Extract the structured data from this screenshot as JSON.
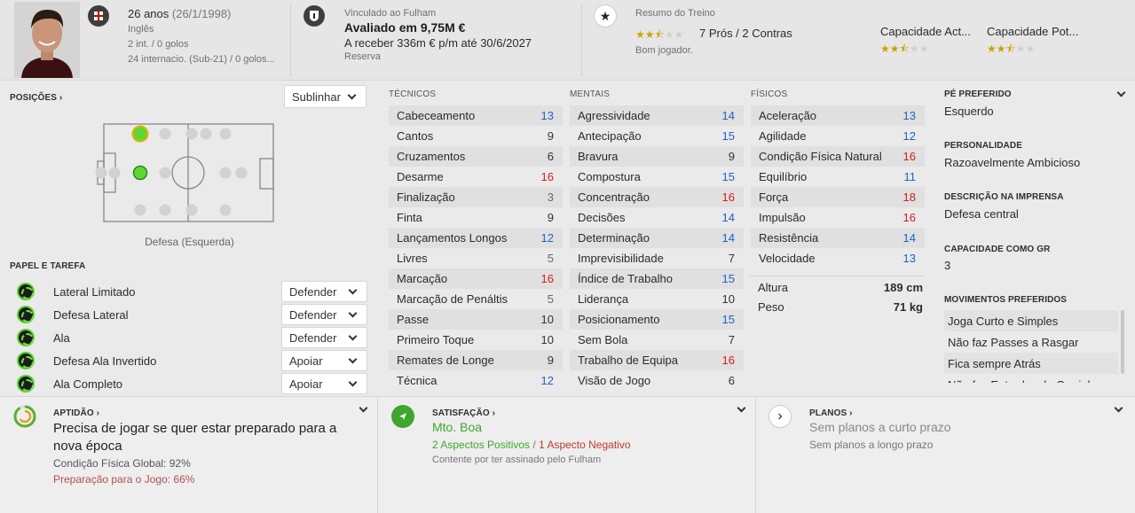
{
  "header": {
    "age": "26 anos",
    "birth": "(26/1/1998)",
    "nationality": "Inglês",
    "caps": "2 int. / 0 golos",
    "youth_caps": "24 internacio. (Sub-21) / 0 golos...",
    "contract_label": "Vinculado ao Fulham",
    "value": "Avaliado em 9,75M €",
    "wage": "A receber 336m € p/m até 30/6/2027",
    "squad_status": "Reserva",
    "training_label": "Resumo do Treino",
    "pros_cons": "7 Prós / 2 Contras",
    "training_verdict": "Bom jogador.",
    "current_ability_label": "Capacidade Act...",
    "potential_ability_label": "Capacidade Pot...",
    "training_stars": 2.5,
    "current_stars": 2.5,
    "potential_stars": 2.5
  },
  "positions": {
    "title": "POSIÇÕES",
    "highlight_select": "Sublinhar",
    "position_label": "Defesa (Esquerda)"
  },
  "roles": {
    "title": "PAPEL E TAREFA",
    "items": [
      {
        "name": "Lateral Limitado",
        "duty": "Defender"
      },
      {
        "name": "Defesa Lateral",
        "duty": "Defender"
      },
      {
        "name": "Ala",
        "duty": "Defender"
      },
      {
        "name": "Defesa Ala Invertido",
        "duty": "Apoiar"
      },
      {
        "name": "Ala Completo",
        "duty": "Apoiar"
      }
    ]
  },
  "attributes": {
    "technical_header": "TÉCNICOS",
    "mental_header": "MENTAIS",
    "physical_header": "FÍSICOS",
    "technical": [
      {
        "name": "Cabeceamento",
        "value": "13",
        "tone": "b"
      },
      {
        "name": "Cantos",
        "value": "9",
        "tone": "d"
      },
      {
        "name": "Cruzamentos",
        "value": "6",
        "tone": "d"
      },
      {
        "name": "Desarme",
        "value": "16",
        "tone": "r"
      },
      {
        "name": "Finalização",
        "value": "3",
        "tone": "g"
      },
      {
        "name": "Finta",
        "value": "9",
        "tone": "d"
      },
      {
        "name": "Lançamentos Longos",
        "value": "12",
        "tone": "b"
      },
      {
        "name": "Livres",
        "value": "5",
        "tone": "g"
      },
      {
        "name": "Marcação",
        "value": "16",
        "tone": "r"
      },
      {
        "name": "Marcação de Penáltis",
        "value": "5",
        "tone": "g"
      },
      {
        "name": "Passe",
        "value": "10",
        "tone": "d"
      },
      {
        "name": "Primeiro Toque",
        "value": "10",
        "tone": "d"
      },
      {
        "name": "Remates de Longe",
        "value": "9",
        "tone": "d"
      },
      {
        "name": "Técnica",
        "value": "12",
        "tone": "b"
      }
    ],
    "mental": [
      {
        "name": "Agressividade",
        "value": "14",
        "tone": "b"
      },
      {
        "name": "Antecipação",
        "value": "15",
        "tone": "b"
      },
      {
        "name": "Bravura",
        "value": "9",
        "tone": "d"
      },
      {
        "name": "Compostura",
        "value": "15",
        "tone": "b"
      },
      {
        "name": "Concentração",
        "value": "16",
        "tone": "r"
      },
      {
        "name": "Decisões",
        "value": "14",
        "tone": "b"
      },
      {
        "name": "Determinação",
        "value": "14",
        "tone": "b"
      },
      {
        "name": "Imprevisibilidade",
        "value": "7",
        "tone": "d"
      },
      {
        "name": "Índice de Trabalho",
        "value": "15",
        "tone": "b"
      },
      {
        "name": "Liderança",
        "value": "10",
        "tone": "d"
      },
      {
        "name": "Posicionamento",
        "value": "15",
        "tone": "b"
      },
      {
        "name": "Sem Bola",
        "value": "7",
        "tone": "d"
      },
      {
        "name": "Trabalho de Equipa",
        "value": "16",
        "tone": "r"
      },
      {
        "name": "Visão de Jogo",
        "value": "6",
        "tone": "d"
      }
    ],
    "physical": [
      {
        "name": "Aceleração",
        "value": "13",
        "tone": "b"
      },
      {
        "name": "Agilidade",
        "value": "12",
        "tone": "b"
      },
      {
        "name": "Condição Física Natural",
        "value": "16",
        "tone": "r"
      },
      {
        "name": "Equilíbrio",
        "value": "11",
        "tone": "b"
      },
      {
        "name": "Força",
        "value": "18",
        "tone": "r"
      },
      {
        "name": "Impulsão",
        "value": "16",
        "tone": "r"
      },
      {
        "name": "Resistência",
        "value": "14",
        "tone": "b"
      },
      {
        "name": "Velocidade",
        "value": "13",
        "tone": "b"
      }
    ],
    "height_label": "Altura",
    "height_value": "189 cm",
    "weight_label": "Peso",
    "weight_value": "71 kg"
  },
  "side": {
    "foot_title": "PÉ PREFERIDO",
    "foot_value": "Esquerdo",
    "personality_title": "PERSONALIDADE",
    "personality_value": "Razoavelmente Ambicioso",
    "media_title": "DESCRIÇÃO NA IMPRENSA",
    "media_value": "Defesa central",
    "gk_title": "CAPACIDADE COMO GR",
    "gk_value": "3",
    "moves_title": "MOVIMENTOS PREFERIDOS",
    "moves": [
      "Joga Curto e Simples",
      "Não faz Passes a Rasgar",
      "Fica sempre Atrás",
      "Não faz Entradas de Carrinho"
    ]
  },
  "fitness": {
    "title": "APTIDÃO",
    "headline": "Precisa de jogar se quer estar preparado para a nova época",
    "condition": "Condição Física Global: 92%",
    "match_prep": "Preparação para o Jogo: 66%"
  },
  "happiness": {
    "title": "SATISFAÇÃO",
    "level": "Mto. Boa",
    "positives": "2 Aspectos Positivos",
    "separator": "/",
    "negatives": "1 Aspecto Negativo",
    "note": "Contente por ter assinado pelo Fulham"
  },
  "plans": {
    "title": "PLANOS",
    "short_term": "Sem planos a curto prazo",
    "long_term": "Sem planos a longo prazo"
  },
  "colors": {
    "blue_value": "#1f62c4",
    "red_value": "#d11e1e",
    "green_accent": "#3fa62d",
    "star_gold": "#c9a400"
  }
}
